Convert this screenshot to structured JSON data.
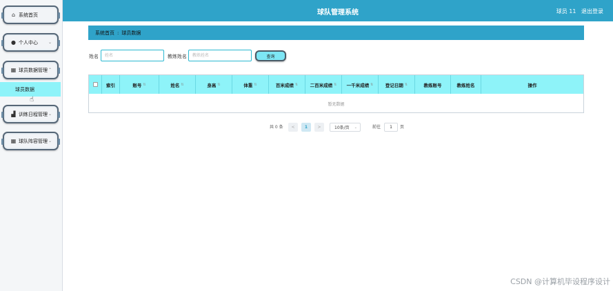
{
  "header": {
    "title": "球队管理系统",
    "user_label": "球员 11",
    "logout_label": "退出登录"
  },
  "sidebar": {
    "items": [
      {
        "label": "系统首页",
        "icon": "home-icon",
        "glyph": "⌂"
      },
      {
        "label": "个人中心",
        "icon": "user-icon",
        "glyph": "●"
      },
      {
        "label": "球员数据管理",
        "icon": "table-icon",
        "glyph": "▦"
      },
      {
        "label": "训练日程管理",
        "icon": "chart-icon",
        "glyph": "▟"
      },
      {
        "label": "球队阵容管理",
        "icon": "grid-icon",
        "glyph": "▦"
      }
    ],
    "submenu": [
      {
        "label": "球员数据"
      }
    ]
  },
  "breadcrumb": {
    "home": "系统首页",
    "separator": ":",
    "current": "球员数据"
  },
  "search": {
    "name_label": "姓名",
    "name_placeholder": "姓名",
    "coach_label": "教练姓名",
    "coach_placeholder": "教练姓名",
    "button_label": "查询"
  },
  "table": {
    "columns": [
      "索引",
      "账号",
      "姓名",
      "身高",
      "体重",
      "百米成绩",
      "二百米成绩",
      "一千米成绩",
      "登记日期",
      "教练账号",
      "教练姓名",
      "操作"
    ],
    "empty_text": "暂无数据"
  },
  "pagination": {
    "total_text": "共 0 条",
    "prev": "<",
    "current_page": "1",
    "next": ">",
    "page_size": "10条/页",
    "goto_label": "前往",
    "goto_value": "1",
    "page_unit": "页"
  },
  "watermark": "CSDN @计算机毕设程序设计",
  "colors": {
    "header": "#2fa3c9",
    "accent": "#8ef3f9",
    "button": "#7de6f5"
  }
}
